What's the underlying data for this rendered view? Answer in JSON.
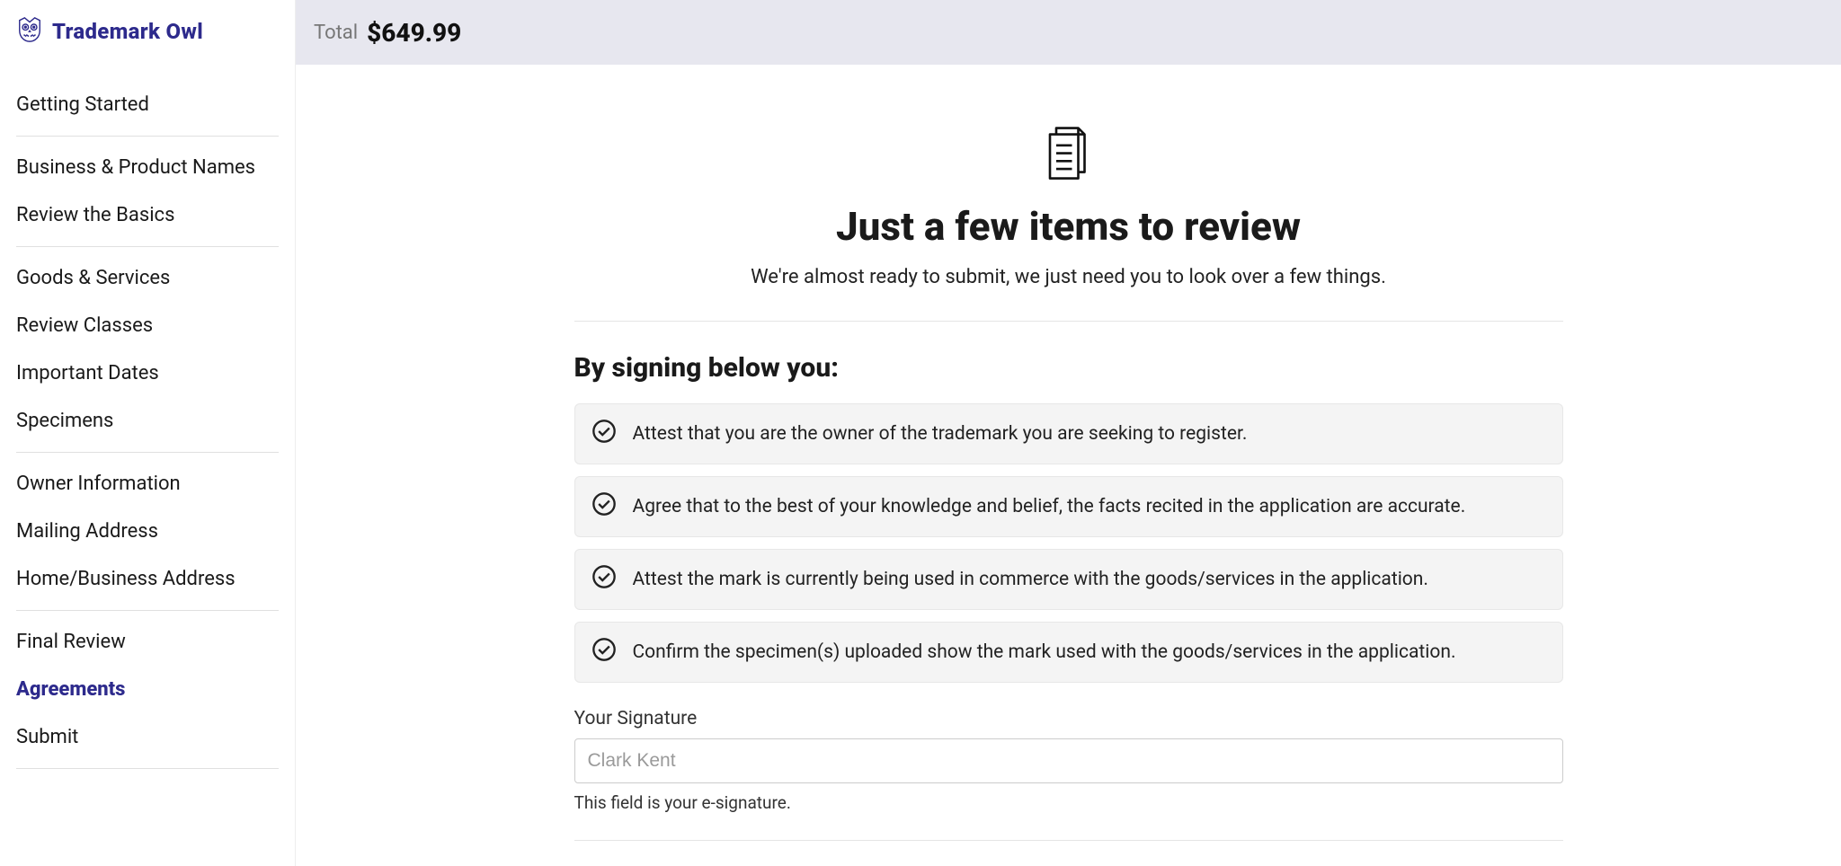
{
  "brand": "Trademark Owl",
  "topbar": {
    "total_label": "Total",
    "total_amount": "$649.99"
  },
  "sidebar": {
    "groups": [
      {
        "items": [
          {
            "label": "Getting Started",
            "active": false
          }
        ]
      },
      {
        "items": [
          {
            "label": "Business & Product Names",
            "active": false
          },
          {
            "label": "Review the Basics",
            "active": false
          }
        ]
      },
      {
        "items": [
          {
            "label": "Goods & Services",
            "active": false
          },
          {
            "label": "Review Classes",
            "active": false
          },
          {
            "label": "Important Dates",
            "active": false
          },
          {
            "label": "Specimens",
            "active": false
          }
        ]
      },
      {
        "items": [
          {
            "label": "Owner Information",
            "active": false
          },
          {
            "label": "Mailing Address",
            "active": false
          },
          {
            "label": "Home/Business Address",
            "active": false
          }
        ]
      },
      {
        "items": [
          {
            "label": "Final Review",
            "active": false
          },
          {
            "label": "Agreements",
            "active": true
          },
          {
            "label": "Submit",
            "active": false
          }
        ]
      }
    ]
  },
  "hero": {
    "title": "Just a few items to review",
    "subtitle": "We're almost ready to submit, we just need you to look over a few things."
  },
  "section_title": "By signing below you:",
  "attestations": [
    "Attest that you are the owner of the trademark you are seeking to register.",
    "Agree that to the best of your knowledge and belief, the facts recited in the application are accurate.",
    "Attest the mark is currently being used in commerce with the goods/services in the application.",
    "Confirm the specimen(s) uploaded show the mark used with the goods/services in the application."
  ],
  "signature": {
    "label": "Your Signature",
    "placeholder": "Clark Kent",
    "value": "",
    "help": "This field is your e-signature."
  }
}
